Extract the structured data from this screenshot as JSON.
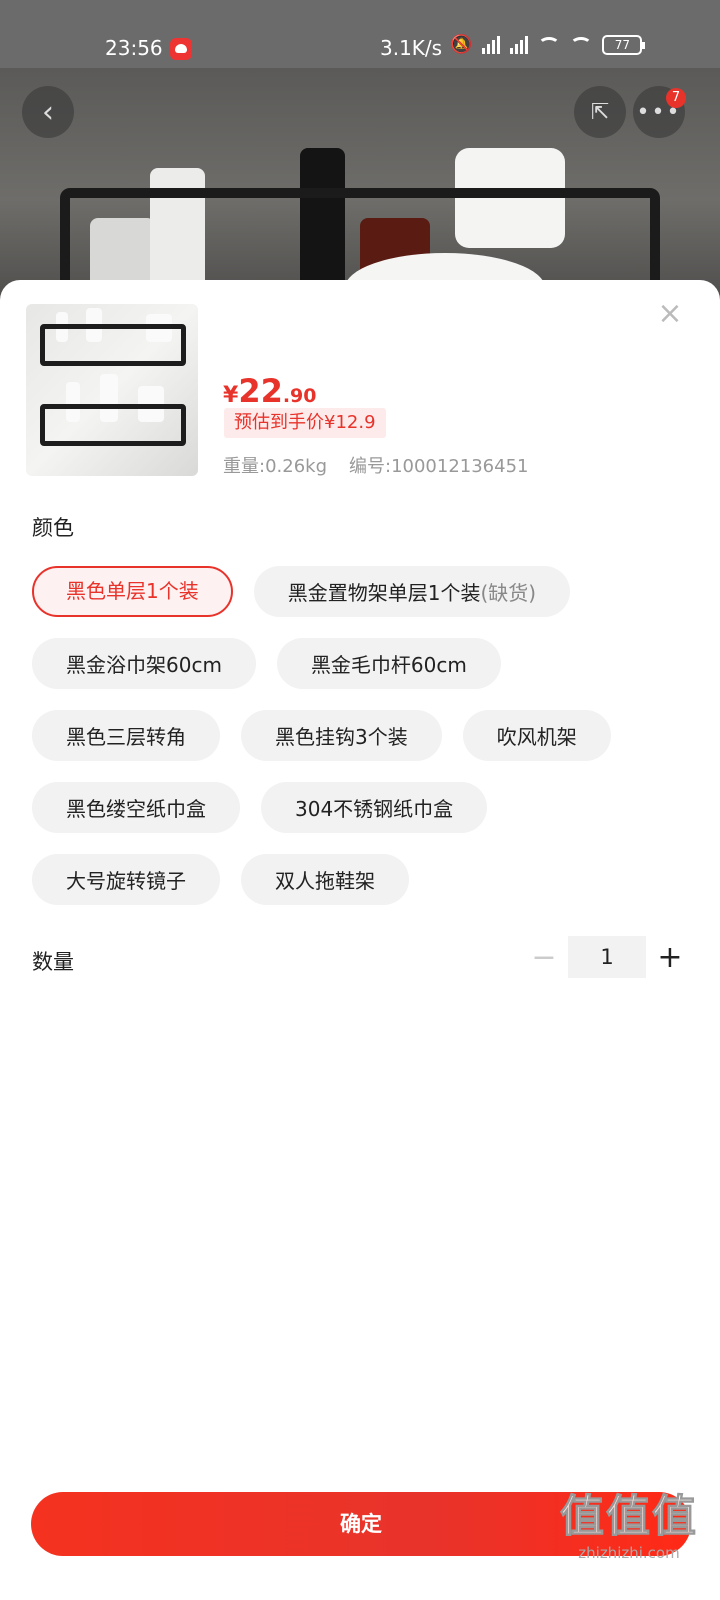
{
  "status_bar": {
    "time": "23:56",
    "net_speed": "3.1K/s",
    "battery": "77"
  },
  "hero": {
    "notification_count": "7"
  },
  "product": {
    "currency": "¥",
    "price_int": "22",
    "price_dec": ".90",
    "estimated_price": "预估到手价¥12.9",
    "weight": "重量:0.26kg",
    "sku": "编号:100012136451"
  },
  "color_section": {
    "title": "颜色",
    "options": [
      {
        "label": "黑色单层1个装",
        "tag": "",
        "selected": true
      },
      {
        "label": "黑金置物架单层1个装",
        "tag": "(缺货)",
        "selected": false
      },
      {
        "label": "黑金浴巾架60cm",
        "tag": "",
        "selected": false
      },
      {
        "label": "黑金毛巾杆60cm",
        "tag": "",
        "selected": false
      },
      {
        "label": "黑色三层转角",
        "tag": "",
        "selected": false
      },
      {
        "label": "黑色挂钩3个装",
        "tag": "",
        "selected": false
      },
      {
        "label": "吹风机架",
        "tag": "",
        "selected": false
      },
      {
        "label": "黑色缕空纸巾盒",
        "tag": "",
        "selected": false
      },
      {
        "label": "304不锈钢纸巾盒",
        "tag": "",
        "selected": false
      },
      {
        "label": "大号旋转镜子",
        "tag": "",
        "selected": false
      },
      {
        "label": "双人拖鞋架",
        "tag": "",
        "selected": false
      }
    ]
  },
  "quantity": {
    "title": "数量",
    "minus": "−",
    "value": "1",
    "plus": "+"
  },
  "confirm_label": "确定",
  "watermark": {
    "logo": "值值值",
    "url": "zhizhizhi.com"
  },
  "colors": {
    "accent": "#e8332b",
    "chip_bg": "#f2f2f2"
  }
}
